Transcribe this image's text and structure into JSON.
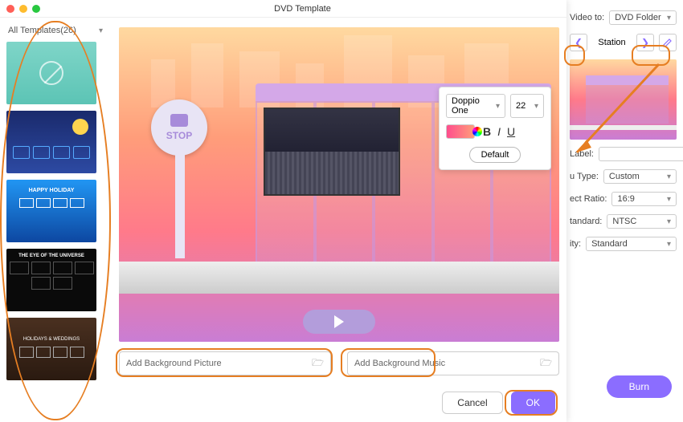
{
  "window": {
    "title": "DVD Template"
  },
  "sidebar": {
    "dropdown": "All Templates(26)",
    "thumbs": {
      "t3": "HAPPY HOLIDAY",
      "t4": "THE EYE OF THE UNIVERSE",
      "t5": "HOLIDAYS & WEDDINGS"
    }
  },
  "preview": {
    "stop": "STOP"
  },
  "font_popup": {
    "font": "Doppio One",
    "size": "22",
    "bold": "B",
    "italic": "I",
    "underline": "U",
    "default": "Default"
  },
  "bg": {
    "picture": "Add Background Picture",
    "music": "Add Background Music"
  },
  "buttons": {
    "cancel": "Cancel",
    "ok": "OK"
  },
  "right": {
    "video_to_label": "Video to:",
    "video_to": "DVD Folder",
    "station": "Station",
    "label_lbl": "Label:",
    "type_lbl": "u Type:",
    "type": "Custom",
    "ratio_lbl": "ect Ratio:",
    "ratio": "16:9",
    "standard_lbl": "tandard:",
    "standard": "NTSC",
    "quality_lbl": "ity:",
    "quality": "Standard",
    "burn": "Burn"
  }
}
